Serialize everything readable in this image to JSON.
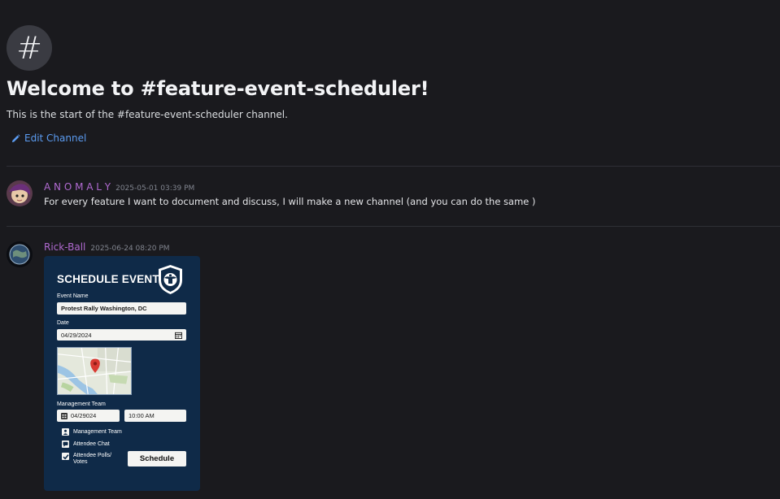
{
  "channel": {
    "hash_symbol": "#",
    "welcome_title": "Welcome to #feature-event-scheduler!",
    "welcome_subtitle": "This is the start of the #feature-event-scheduler channel.",
    "edit_label": "Edit Channel",
    "edit_icon": "pencil-icon"
  },
  "messages": [
    {
      "author": "A N O M A L Y",
      "author_color": "#b06ad0",
      "timestamp": "2025-05-01 03:39 PM",
      "text": "For every feature I want to document and discuss, I will make a new channel (and you can do the same )"
    },
    {
      "author": "Rick-Ball",
      "author_color": "#b06ad0",
      "timestamp": "2025-06-24 08:20 PM"
    }
  ],
  "event_card": {
    "title": "SCHEDULE EVENT",
    "seal_icon": "eagle-seal-icon",
    "event_name_label": "Event Name",
    "event_name_value": "Protest Rally Washington, DC",
    "date_label": "Date",
    "date_value": "04/29/2024",
    "management_label": "Management Team",
    "mgmt_date_value": "04/29024",
    "mgmt_time_value": "10:00 AM",
    "checks": [
      {
        "label": "Management Team",
        "icon": "person-icon"
      },
      {
        "label": "Attendee Chat",
        "icon": "chat-icon"
      },
      {
        "label_line1": "Attendee Polls/",
        "label_line2": "Votes",
        "icon": "checkmark-icon"
      }
    ],
    "schedule_label": "Schedule"
  },
  "colors": {
    "background": "#1a1a1e",
    "link": "#5b9bf0",
    "card": "#0f2a48"
  }
}
